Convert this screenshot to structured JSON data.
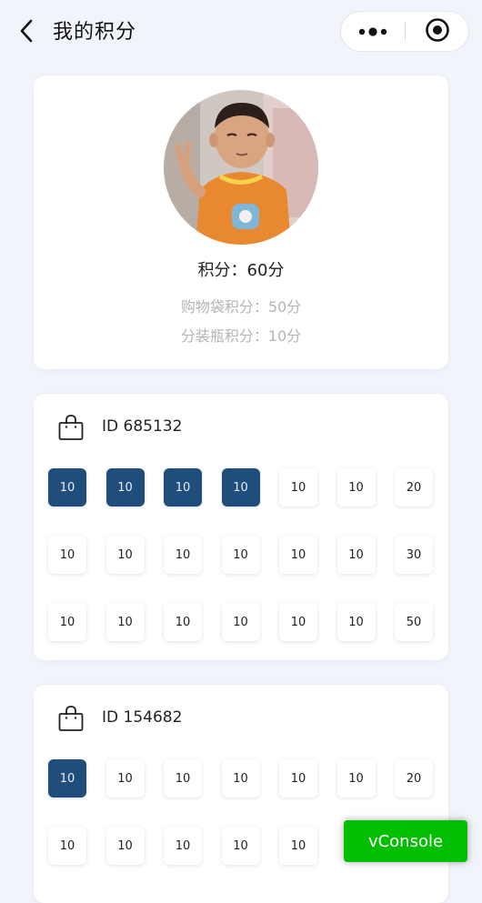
{
  "navbar": {
    "title": "我的积分"
  },
  "profile": {
    "total_points": "积分：60分",
    "bag_points": "购物袋积分：50分",
    "bottle_points": "分装瓶积分：10分"
  },
  "bags": [
    {
      "id_label": "ID 685132",
      "rows": [
        [
          {
            "value": "10",
            "active": true
          },
          {
            "value": "10",
            "active": true
          },
          {
            "value": "10",
            "active": true
          },
          {
            "value": "10",
            "active": true
          },
          {
            "value": "10",
            "active": false
          },
          {
            "value": "10",
            "active": false
          },
          {
            "value": "20",
            "active": false
          }
        ],
        [
          {
            "value": "10",
            "active": false
          },
          {
            "value": "10",
            "active": false
          },
          {
            "value": "10",
            "active": false
          },
          {
            "value": "10",
            "active": false
          },
          {
            "value": "10",
            "active": false
          },
          {
            "value": "10",
            "active": false
          },
          {
            "value": "30",
            "active": false
          }
        ],
        [
          {
            "value": "10",
            "active": false
          },
          {
            "value": "10",
            "active": false
          },
          {
            "value": "10",
            "active": false
          },
          {
            "value": "10",
            "active": false
          },
          {
            "value": "10",
            "active": false
          },
          {
            "value": "10",
            "active": false
          },
          {
            "value": "50",
            "active": false
          }
        ]
      ]
    },
    {
      "id_label": "ID 154682",
      "rows": [
        [
          {
            "value": "10",
            "active": true
          },
          {
            "value": "10",
            "active": false
          },
          {
            "value": "10",
            "active": false
          },
          {
            "value": "10",
            "active": false
          },
          {
            "value": "10",
            "active": false
          },
          {
            "value": "10",
            "active": false
          },
          {
            "value": "20",
            "active": false
          }
        ],
        [
          {
            "value": "10",
            "active": false
          },
          {
            "value": "10",
            "active": false
          },
          {
            "value": "10",
            "active": false
          },
          {
            "value": "10",
            "active": false
          },
          {
            "value": "10",
            "active": false
          }
        ]
      ]
    }
  ],
  "vconsole": {
    "label": "vConsole"
  },
  "colors": {
    "active_cell": "#1f4e7c",
    "vconsole_bg": "#04be02"
  }
}
